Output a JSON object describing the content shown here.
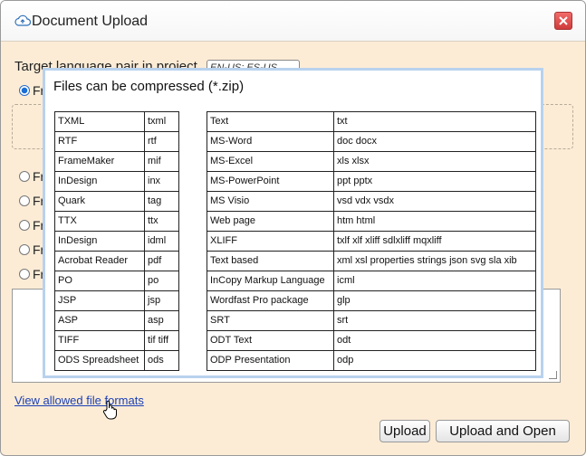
{
  "window": {
    "title": "Document Upload",
    "icon": "cloud-upload-icon"
  },
  "form": {
    "target_label": "Target language pair in project",
    "target_value": "EN-US: ES-US",
    "radio_prefix": "Fr",
    "radios_checked": [
      true,
      false,
      false,
      false,
      false,
      false
    ]
  },
  "link": {
    "view_formats": "View allowed file formats"
  },
  "buttons": {
    "upload": "Upload",
    "upload_open": "Upload and Open"
  },
  "popup": {
    "title": "Files can be compressed (*.zip)",
    "left_rows": [
      [
        "TXML",
        "txml"
      ],
      [
        "RTF",
        "rtf"
      ],
      [
        "FrameMaker",
        "mif"
      ],
      [
        "InDesign",
        "inx"
      ],
      [
        "Quark",
        "tag"
      ],
      [
        "TTX",
        "ttx"
      ],
      [
        "InDesign",
        "idml"
      ],
      [
        "Acrobat Reader",
        "pdf"
      ],
      [
        "PO",
        "po"
      ],
      [
        "JSP",
        "jsp"
      ],
      [
        "ASP",
        "asp"
      ],
      [
        "TIFF",
        "tif tiff"
      ],
      [
        "ODS Spreadsheet",
        "ods"
      ]
    ],
    "right_rows": [
      [
        "Text",
        "txt"
      ],
      [
        "MS-Word",
        "doc docx"
      ],
      [
        "MS-Excel",
        "xls xlsx"
      ],
      [
        "MS-PowerPoint",
        "ppt pptx"
      ],
      [
        "MS Visio",
        "vsd vdx vsdx"
      ],
      [
        "Web page",
        "htm html"
      ],
      [
        "XLIFF",
        "txlf xlf xliff sdlxliff mqxliff"
      ],
      [
        "Text based",
        "xml xsl properties strings json svg sla xib"
      ],
      [
        "InCopy Markup Language",
        "icml"
      ],
      [
        "Wordfast Pro package",
        "glp"
      ],
      [
        "SRT",
        "srt"
      ],
      [
        "ODT Text",
        "odt"
      ],
      [
        "ODP Presentation",
        "odp"
      ]
    ]
  },
  "colors": {
    "dialog_bg": "#fcecd6",
    "popup_border": "#b8d2ee",
    "link": "#1a3fb5",
    "close_button": "#d94545"
  }
}
